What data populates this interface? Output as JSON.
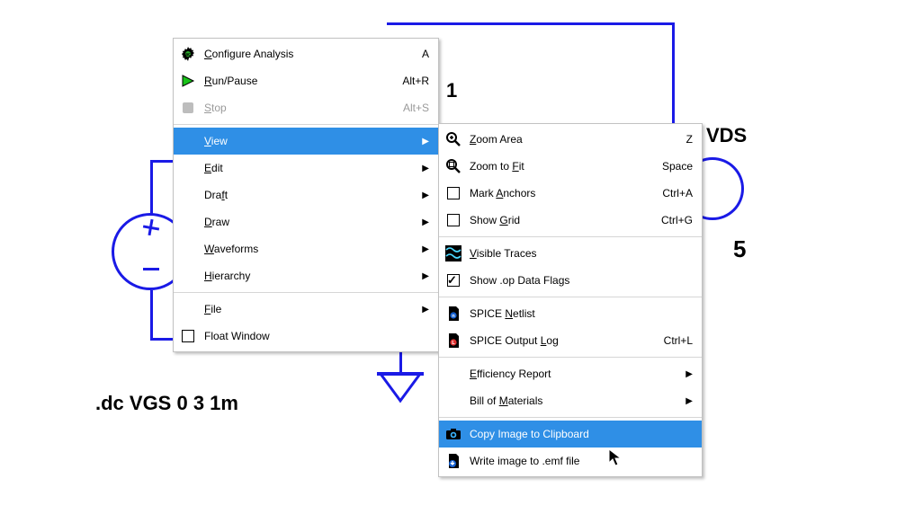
{
  "schematic": {
    "labels": {
      "m1_partial": "1",
      "vds": "VDS",
      "val5": "5"
    },
    "directive": ".dc VGS 0 3 1m"
  },
  "context_menu": {
    "items": [
      {
        "label": "Configure Analysis",
        "underline_idx": 0,
        "shortcut": "A",
        "icon": "gear-icon"
      },
      {
        "label": "Run/Pause",
        "underline_idx": 0,
        "shortcut": "Alt+R",
        "icon": "play-icon"
      },
      {
        "label": "Stop",
        "underline_idx": 0,
        "shortcut": "Alt+S",
        "icon": "stop-icon",
        "disabled": true
      },
      {
        "sep": true
      },
      {
        "label": "View",
        "underline_idx": 0,
        "submenu": true,
        "highlighted": true
      },
      {
        "label": "Edit",
        "underline_idx": 0,
        "submenu": true
      },
      {
        "label": "Draft",
        "underline_idx": 3,
        "submenu": true
      },
      {
        "label": "Draw",
        "underline_idx": 0,
        "submenu": true
      },
      {
        "label": "Waveforms",
        "underline_idx": 0,
        "submenu": true
      },
      {
        "label": "Hierarchy",
        "underline_idx": 0,
        "submenu": true
      },
      {
        "sep": true
      },
      {
        "label": "File",
        "underline_idx": 0,
        "submenu": true
      },
      {
        "label": "Float Window",
        "icon": "checkbox-empty"
      }
    ]
  },
  "view_submenu": {
    "items": [
      {
        "label": "Zoom Area",
        "underline_idx": 0,
        "shortcut": "Z",
        "icon": "zoom-in-icon"
      },
      {
        "label": "Zoom to Fit",
        "underline_idx": 8,
        "shortcut": "Space",
        "icon": "zoom-fit-icon"
      },
      {
        "label": "Mark Anchors",
        "underline_idx": 5,
        "shortcut": "Ctrl+A",
        "icon": "checkbox-empty"
      },
      {
        "label": "Show Grid",
        "underline_idx": 5,
        "shortcut": "Ctrl+G",
        "icon": "checkbox-empty"
      },
      {
        "sep": true
      },
      {
        "label": "Visible Traces",
        "underline_idx": 0,
        "icon": "waves-icon"
      },
      {
        "label": "Show .op Data Flags",
        "icon": "checkbox-checked"
      },
      {
        "sep": true
      },
      {
        "label": "SPICE Netlist",
        "underline_idx": 6,
        "icon": "netlist-icon"
      },
      {
        "label": "SPICE Output Log",
        "underline_idx": 13,
        "shortcut": "Ctrl+L",
        "icon": "log-icon"
      },
      {
        "sep": true
      },
      {
        "label": "Efficiency Report",
        "underline_idx": 0,
        "submenu": true
      },
      {
        "label": "Bill of Materials",
        "underline_idx": 8,
        "submenu": true
      },
      {
        "sep": true
      },
      {
        "label": "Copy Image to Clipboard",
        "icon": "camera-icon",
        "highlighted": true
      },
      {
        "label": "Write image to .emf file",
        "icon": "save-emf-icon"
      }
    ]
  }
}
